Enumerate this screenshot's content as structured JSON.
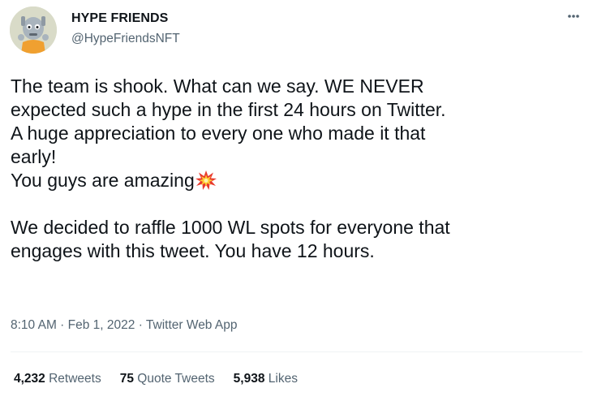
{
  "author": {
    "display_name": "HYPE FRIENDS",
    "handle": "@HypeFriendsNFT",
    "avatar_icon": "nft-character-avatar"
  },
  "more_icon": "more-dots-icon",
  "tweet": {
    "paragraph_1": "The team is shook. What can we say. WE NEVER\nexpected such a hype in the first 24 hours on Twitter.\nA huge appreciation to every one who made it that\nearly!\nYou guys are amazing",
    "emoji": "collision-emoji",
    "paragraph_2": "\n\nWe decided to raffle 1000 WL spots for everyone that\nengages with this tweet. You have 12 hours."
  },
  "meta": {
    "time": "8:10 AM",
    "sep1": " · ",
    "date": "Feb 1, 2022",
    "sep2": " · ",
    "source": "Twitter Web App"
  },
  "stats": {
    "retweets_count": "4,232",
    "retweets_label": "Retweets",
    "quotes_count": "75",
    "quotes_label": "Quote Tweets",
    "likes_count": "5,938",
    "likes_label": "Likes"
  },
  "colors": {
    "text": "#0f1419",
    "secondary": "#536471",
    "divider": "#eff3f4",
    "avatar_bg": "#d9dbc8",
    "avatar_accent": "#f0a030"
  }
}
